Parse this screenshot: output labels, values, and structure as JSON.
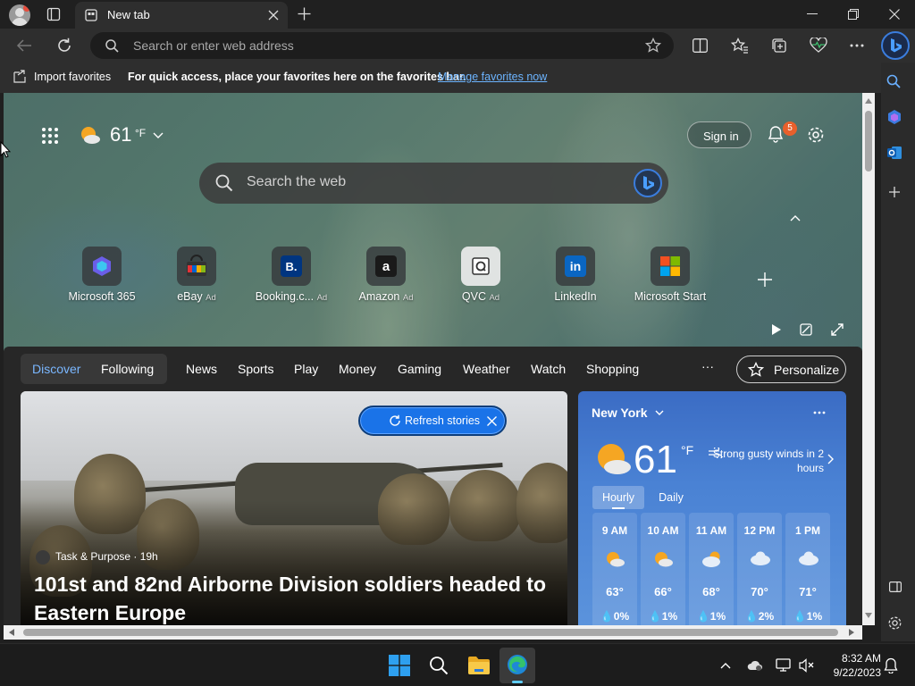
{
  "window": {
    "tab_title": "New tab"
  },
  "toolbar": {
    "address_placeholder": "Search or enter web address"
  },
  "favorites_bar": {
    "import_label": "Import favorites",
    "message": "For quick access, place your favorites here on the favorites bar.",
    "manage_link": "Manage favorites now"
  },
  "header": {
    "weather_temp": "61",
    "weather_unit": "°F",
    "sign_in": "Sign in",
    "notification_count": "5"
  },
  "search": {
    "placeholder": "Search the web"
  },
  "quick_links": [
    {
      "name": "Microsoft 365",
      "ad": "",
      "icon": "microsoft-365-icon"
    },
    {
      "name": "eBay",
      "ad": "Ad",
      "icon": "ebay-icon"
    },
    {
      "name": "Booking.c...",
      "ad": "Ad",
      "icon": "booking-icon"
    },
    {
      "name": "Amazon",
      "ad": "Ad",
      "icon": "amazon-icon"
    },
    {
      "name": "QVC",
      "ad": "Ad",
      "icon": "qvc-icon"
    },
    {
      "name": "LinkedIn",
      "ad": "",
      "icon": "linkedin-icon"
    },
    {
      "name": "Microsoft Start",
      "ad": "",
      "icon": "microsoft-start-icon"
    }
  ],
  "feed_nav": {
    "discover": "Discover",
    "following": "Following",
    "items": [
      "News",
      "Sports",
      "Play",
      "Money",
      "Gaming",
      "Weather",
      "Watch",
      "Shopping"
    ],
    "more": "···",
    "personalize": "Personalize"
  },
  "refresh": {
    "label": "Refresh stories"
  },
  "story": {
    "source": "Task & Purpose · 19h",
    "headline": "101st and 82nd Airborne Division soldiers headed to Eastern Europe"
  },
  "weather": {
    "city": "New York",
    "temp": "61",
    "unit": "°F",
    "alert": "Strong gusty winds in 2 hours",
    "tabs": [
      "Hourly",
      "Daily"
    ],
    "hourly": [
      {
        "time": "9 AM",
        "temp": "63°",
        "precip": "0%",
        "icon": "sun-cloud"
      },
      {
        "time": "10 AM",
        "temp": "66°",
        "precip": "1%",
        "icon": "sun-cloud"
      },
      {
        "time": "11 AM",
        "temp": "68°",
        "precip": "1%",
        "icon": "cloud-sun"
      },
      {
        "time": "12 PM",
        "temp": "70°",
        "precip": "2%",
        "icon": "cloud"
      },
      {
        "time": "1 PM",
        "temp": "71°",
        "precip": "1%",
        "icon": "cloud"
      }
    ]
  },
  "taskbar": {
    "time": "8:32 AM",
    "date": "9/22/2023"
  },
  "colors": {
    "accent": "#1a73e8",
    "link": "#6cb4ff",
    "weather_card": "#4a82d4",
    "notification_badge": "#e8602c"
  }
}
